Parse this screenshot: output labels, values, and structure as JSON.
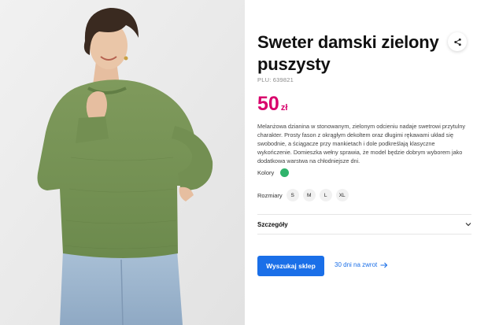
{
  "product": {
    "title": "Sweter damski zielony puszysty",
    "plu": "PLU: 639821",
    "price_value": "50",
    "price_currency": "zł",
    "description": "Melanżowa dzianina w stonowanym, zielonym odcieniu nadaje swetrowi przytulny charakter. Prosty fason z okrągłym dekoltem oraz długimi rękawami układ się swobodnie, a ściągacze przy mankietach i dole podkreślają klasyczne wykończenie. Domieszka wełny sprawia, że model będzie dobrym wyborem jako dodatkowa warstwa na chłodniejsze dni.",
    "share_icon": "share-icon"
  },
  "colors": {
    "label": "Kolory",
    "selected_color": "#2fb36b"
  },
  "sizes": {
    "label": "Rozmiary",
    "options": [
      "S",
      "M",
      "L",
      "XL"
    ]
  },
  "details": {
    "label": "Szczegóły",
    "icon": "chevron-down-icon"
  },
  "actions": {
    "find_store": "Wyszukaj sklep",
    "returns": "30 dni na zwrot",
    "returns_icon": "arrow-right-icon"
  },
  "theme": {
    "price_color": "#d8006b",
    "accent": "#1a6fe8"
  }
}
